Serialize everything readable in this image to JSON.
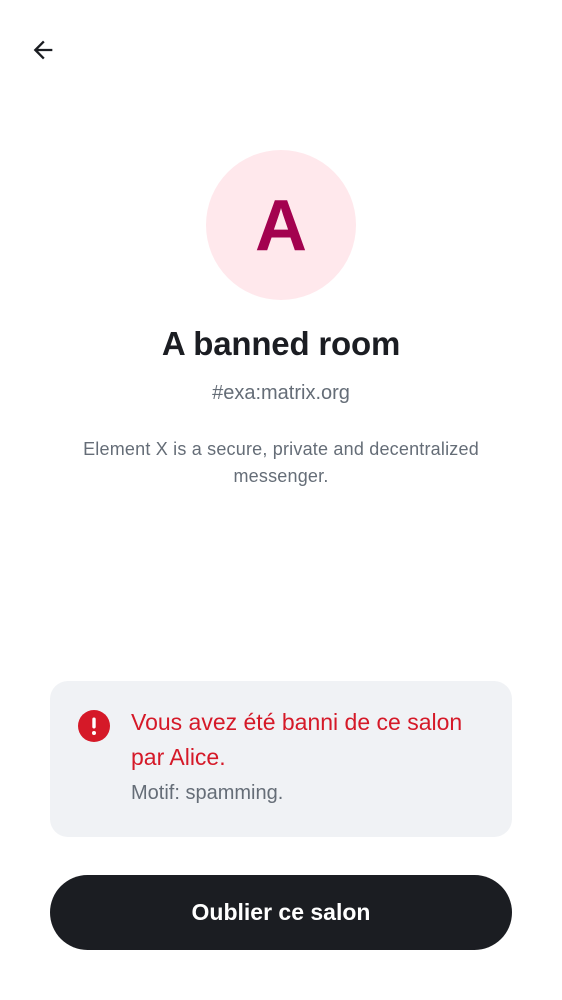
{
  "header": {
    "back_icon": "arrow-left-icon"
  },
  "room": {
    "avatar_letter": "A",
    "avatar_bg_color": "#ffe8ec",
    "avatar_fg_color": "#a3024f",
    "name": "A banned room",
    "alias": "#exa:matrix.org",
    "topic": "Element X is a secure, private and decentralized messenger."
  },
  "ban_notice": {
    "icon": "error-icon",
    "title": "Vous avez été banni de ce salon par Alice.",
    "reason": "Motif: spamming.",
    "accent_color": "#d51928"
  },
  "actions": {
    "forget_label": "Oublier ce salon"
  }
}
